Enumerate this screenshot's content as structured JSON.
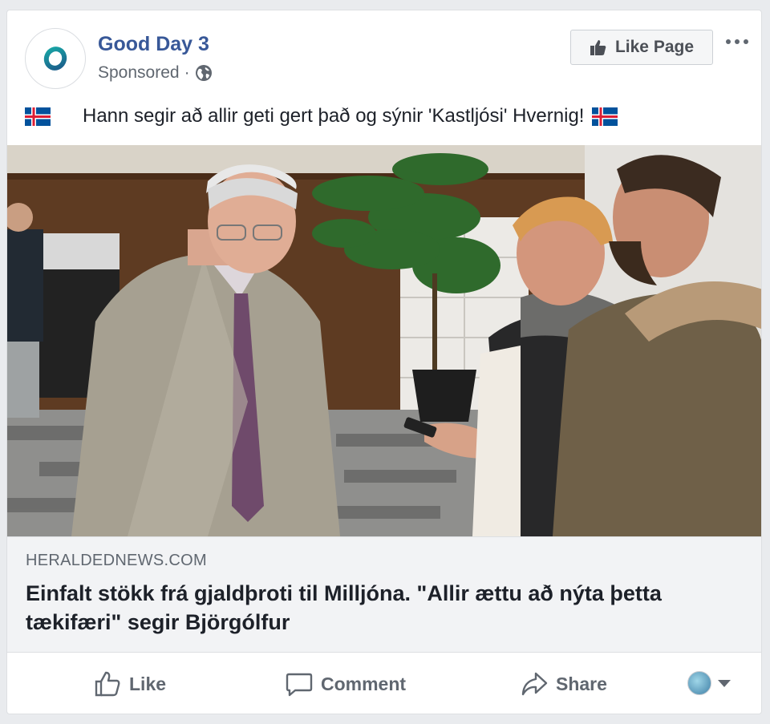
{
  "post": {
    "page_name": "Good Day 3",
    "sponsored": "Sponsored",
    "separator": "·",
    "privacy_icon": "globe-icon",
    "like_page_label": "Like Page",
    "message": "Hann segir að allir geti gert það og sýnir 'Kastljósi' Hvernig!"
  },
  "link": {
    "domain": "HERALDEDNEWS.COM",
    "headline": "Einfalt stökk frá gjaldþroti til Milljóna. \"Allir ættu að nýta þetta tækifæri\" segir Björgólfur"
  },
  "actions": {
    "like": "Like",
    "comment": "Comment",
    "share": "Share"
  },
  "colors": {
    "page_name": "#385898",
    "text": "#1d2129",
    "secondary": "#606770",
    "logo_ring": "#17a2a0"
  }
}
